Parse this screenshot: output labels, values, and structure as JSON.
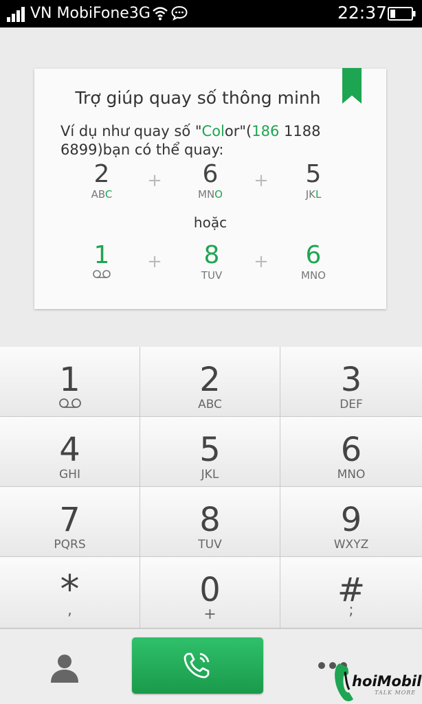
{
  "status_bar": {
    "carrier": "VN MobiFone3G",
    "time": "22:37",
    "icons": [
      "signal-icon",
      "wifi-icon",
      "chat-icon",
      "battery-icon"
    ]
  },
  "help_card": {
    "title": "Trợ giúp quay số thông minh",
    "desc_prefix": "Ví dụ như quay số \"",
    "desc_word_green": "Col",
    "desc_word_rest": "or",
    "desc_mid": "\"(",
    "desc_num_green": "186",
    "desc_suffix": " 1188 6899)bạn có thể quay:",
    "or_text": "hoặc",
    "option1": [
      {
        "digit": "2",
        "letters_plain": "AB",
        "letters_green": "C"
      },
      {
        "digit": "6",
        "letters_plain": "MN",
        "letters_green": "O"
      },
      {
        "digit": "5",
        "letters_plain": "JK",
        "letters_green": "L"
      }
    ],
    "option2": [
      {
        "digit": "1",
        "letters_plain": "",
        "letters_green": "",
        "icon": "voicemail-icon"
      },
      {
        "digit": "8",
        "letters_plain": "TUV",
        "letters_green": ""
      },
      {
        "digit": "6",
        "letters_plain": "MNO",
        "letters_green": ""
      }
    ],
    "plus": "+"
  },
  "keypad": [
    {
      "digit": "1",
      "letters": "",
      "icon": "voicemail-icon"
    },
    {
      "digit": "2",
      "letters": "ABC"
    },
    {
      "digit": "3",
      "letters": "DEF"
    },
    {
      "digit": "4",
      "letters": "GHI"
    },
    {
      "digit": "5",
      "letters": "JKL"
    },
    {
      "digit": "6",
      "letters": "MNO"
    },
    {
      "digit": "7",
      "letters": "PQRS"
    },
    {
      "digit": "8",
      "letters": "TUV"
    },
    {
      "digit": "9",
      "letters": "WXYZ"
    },
    {
      "digit": "*",
      "letters": ","
    },
    {
      "digit": "0",
      "letters": "+"
    },
    {
      "digit": "#",
      "letters": ";"
    }
  ],
  "bottom_bar": {
    "contacts_icon": "person-icon",
    "call_icon": "phone-call-icon",
    "more_icon": "more-dots-icon"
  },
  "watermark": {
    "brand": "hoiMobile",
    "tagline": "TALK MORE"
  },
  "colors": {
    "accent_green": "#1ea552",
    "status_bar": "#000000",
    "background": "#ebebeb"
  }
}
